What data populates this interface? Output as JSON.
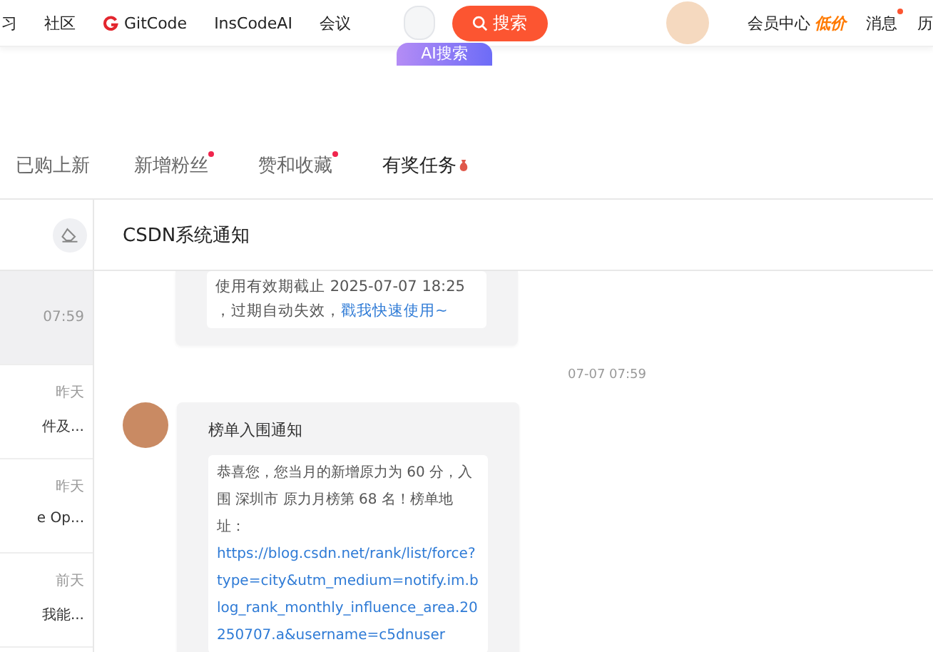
{
  "top_nav": {
    "items": [
      "习",
      "社区",
      "GitCode",
      "InsCodeAI",
      "会议"
    ],
    "search_button": "搜索",
    "ai_search": "AI搜索",
    "member_center": "会员中心",
    "member_badge": "低价",
    "messages": "消息",
    "messages_unread": true,
    "history": "历"
  },
  "tabs": [
    {
      "label": "已购上新",
      "selected": false,
      "unread": false
    },
    {
      "label": "新增粉丝",
      "selected": false,
      "unread": true
    },
    {
      "label": "赞和收藏",
      "selected": false,
      "unread": true
    },
    {
      "label": "有奖任务",
      "selected": true,
      "unread": false
    }
  ],
  "conversation": {
    "title": "CSDN系统通知"
  },
  "sidebar": {
    "items": [
      {
        "time": "07:59",
        "selected": true
      },
      {
        "time": "昨天",
        "preview": "件及...",
        "selected": false
      },
      {
        "time": "昨天",
        "preview": "e Op...",
        "selected": false
      },
      {
        "time": "前天",
        "preview": "我能...",
        "selected": false
      }
    ]
  },
  "messages": [
    {
      "kind": "partial",
      "lines": [
        "使用有效期截止 2025-07-07 18:25"
      ],
      "text": "，过期自动失效，",
      "link": "戳我快速使用~"
    },
    {
      "kind": "time",
      "text": "07-07 07:59"
    },
    {
      "kind": "notice",
      "title": "榜单入围通知",
      "text": "恭喜您，您当月的新增原力为 60 分，入围 深圳市 原力月榜第 68 名！榜单地址：",
      "link": "https://blog.csdn.net/rank/list/force?type=city&utm_medium=notify.im.blog_rank_monthly_influence_area.20250707.a&username=c5dnuser"
    }
  ]
}
